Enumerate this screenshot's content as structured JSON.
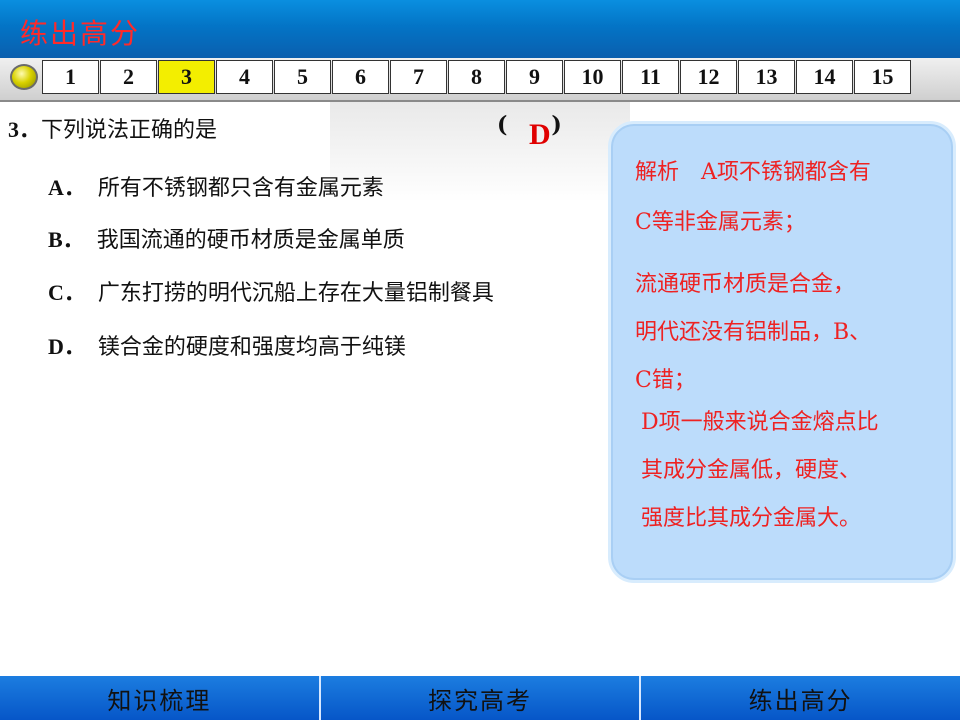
{
  "header": {
    "title": "练出高分"
  },
  "nav": {
    "numbers": [
      "1",
      "2",
      "3",
      "4",
      "5",
      "6",
      "7",
      "8",
      "9",
      "10",
      "11",
      "12",
      "13",
      "14",
      "15"
    ],
    "active": "3"
  },
  "question": {
    "number": "3．",
    "stem": "下列说法正确的是",
    "paren_open": "(",
    "paren_close": ")",
    "answer": "D",
    "options": [
      {
        "letter": "A．",
        "text": "所有不锈钢都只含有金属元素"
      },
      {
        "letter": "B．",
        "text": "我国流通的硬币材质是金属单质"
      },
      {
        "letter": "C．",
        "text": "广东打捞的明代沉船上存在大量铝制餐具"
      },
      {
        "letter": "D．",
        "text": "镁合金的硬度和强度均高于纯镁"
      }
    ]
  },
  "analysis": {
    "lines": [
      "解析　A项不锈钢都含有",
      "C等非金属元素；",
      "流通硬币材质是合金，",
      "明代还没有铝制品，B、",
      "C错；",
      "D项一般来说合金熔点比",
      "其成分金属低，硬度、",
      "强度比其成分金属大。"
    ]
  },
  "footer": {
    "items": [
      "知识梳理",
      "探究高考",
      "练出高分"
    ]
  },
  "colors": {
    "banner": "#0374c6",
    "title": "#ff2a2a",
    "active_nav": "#f3ee00",
    "answer": "#e00000",
    "analysis_bg": "#bcdcfb",
    "analysis_text": "#ee2222",
    "footer": "#0656c8"
  }
}
